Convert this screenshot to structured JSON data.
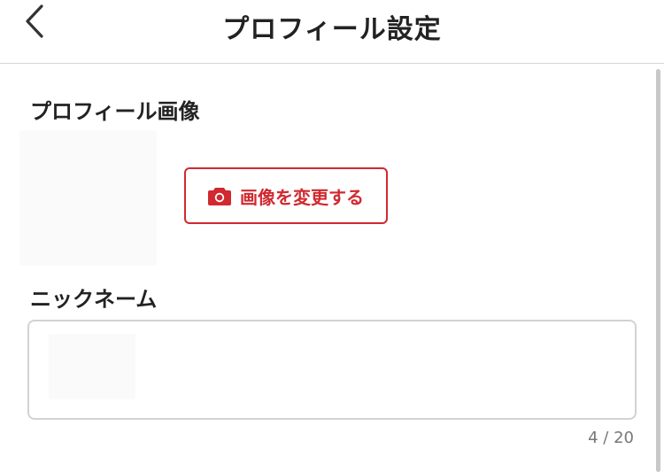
{
  "header": {
    "title": "プロフィール設定",
    "back_icon": "chevron-left-icon"
  },
  "profile_image": {
    "label": "プロフィール画像",
    "change_button_label": "画像を変更する",
    "change_button_icon": "camera-icon"
  },
  "nickname": {
    "label": "ニックネーム",
    "counter": "4 / 20"
  },
  "colors": {
    "accent": "#d0292f",
    "text": "#222222",
    "border": "#d2d2d2",
    "muted": "#777777"
  }
}
